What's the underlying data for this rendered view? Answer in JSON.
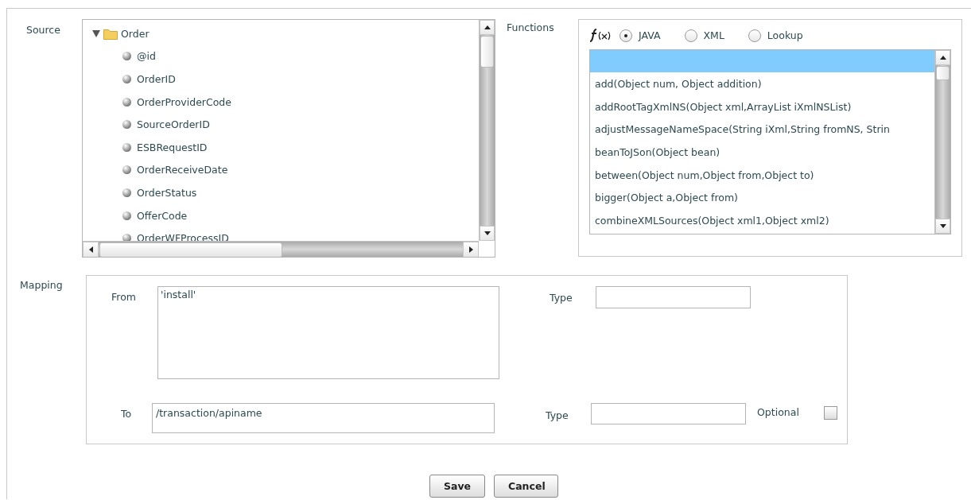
{
  "source": {
    "label": "Source",
    "tree": {
      "label": "Order",
      "expanded": true,
      "children": [
        {
          "label": "@id"
        },
        {
          "label": "OrderID"
        },
        {
          "label": "OrderProviderCode"
        },
        {
          "label": "SourceOrderID"
        },
        {
          "label": "ESBRequestID"
        },
        {
          "label": "OrderReceiveDate"
        },
        {
          "label": "OrderStatus"
        },
        {
          "label": "OfferCode"
        },
        {
          "label": "OrderWFProcessID"
        }
      ]
    }
  },
  "functions": {
    "label": "Functions",
    "modes": [
      {
        "label": "JAVA",
        "selected": true
      },
      {
        "label": "XML",
        "selected": false
      },
      {
        "label": "Lookup",
        "selected": false
      }
    ],
    "blank_row_selected": true,
    "items": [
      {
        "text": "add(Object num, Object addition)",
        "selected": false
      },
      {
        "text": "addRootTagXmlNS(Object xml,ArrayList iXmlNSList)",
        "selected": false
      },
      {
        "text": "adjustMessageNameSpace(String iXml,String fromNS, Strin",
        "selected": false
      },
      {
        "text": "beanToJSon(Object bean)",
        "selected": false
      },
      {
        "text": "between(Object num,Object from,Object to)",
        "selected": false
      },
      {
        "text": "bigger(Object a,Object from)",
        "selected": false
      },
      {
        "text": "combineXMLSources(Object xml1,Object xml2)",
        "selected": false
      }
    ]
  },
  "mapping": {
    "label": "Mapping",
    "from": {
      "label": "From",
      "value": "'install'"
    },
    "from_type": {
      "label": "Type"
    },
    "to": {
      "label": "To",
      "value": "/transaction/apiname"
    },
    "to_type": {
      "label": "Type"
    },
    "optional": {
      "label": "Optional",
      "checked": false
    }
  },
  "buttons": [
    "Save",
    "Cancel"
  ]
}
